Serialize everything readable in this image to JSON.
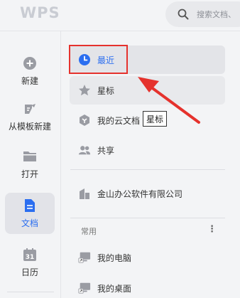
{
  "app": {
    "logo_text": "WPS"
  },
  "search": {
    "placeholder": "搜索文档、"
  },
  "rail": {
    "items": [
      {
        "label": "新建",
        "icon": "plus-circle-icon"
      },
      {
        "label": "从模板新建",
        "icon": "template-icon"
      },
      {
        "label": "打开",
        "icon": "folder-icon"
      },
      {
        "label": "文档",
        "icon": "document-icon",
        "active": true
      },
      {
        "label": "日历",
        "icon": "calendar-icon",
        "badge": "31"
      }
    ]
  },
  "nav": {
    "items": [
      {
        "label": "最近",
        "icon": "clock-icon",
        "selected": true
      },
      {
        "label": "星标",
        "icon": "star-icon"
      },
      {
        "label": "我的云文档",
        "icon": "cloud-doc-icon"
      },
      {
        "label": "共享",
        "icon": "share-icon"
      },
      {
        "label": "金山办公软件有限公司",
        "icon": "company-icon"
      }
    ]
  },
  "tooltip": {
    "text": "星标"
  },
  "common": {
    "title": "常用",
    "items": [
      {
        "label": "我的电脑",
        "icon": "computer-icon"
      },
      {
        "label": "我的桌面",
        "icon": "desktop-icon"
      }
    ]
  },
  "colors": {
    "accent": "#2b6ef0",
    "highlight": "#e5322d",
    "icon_gray": "#9a9ca3"
  }
}
